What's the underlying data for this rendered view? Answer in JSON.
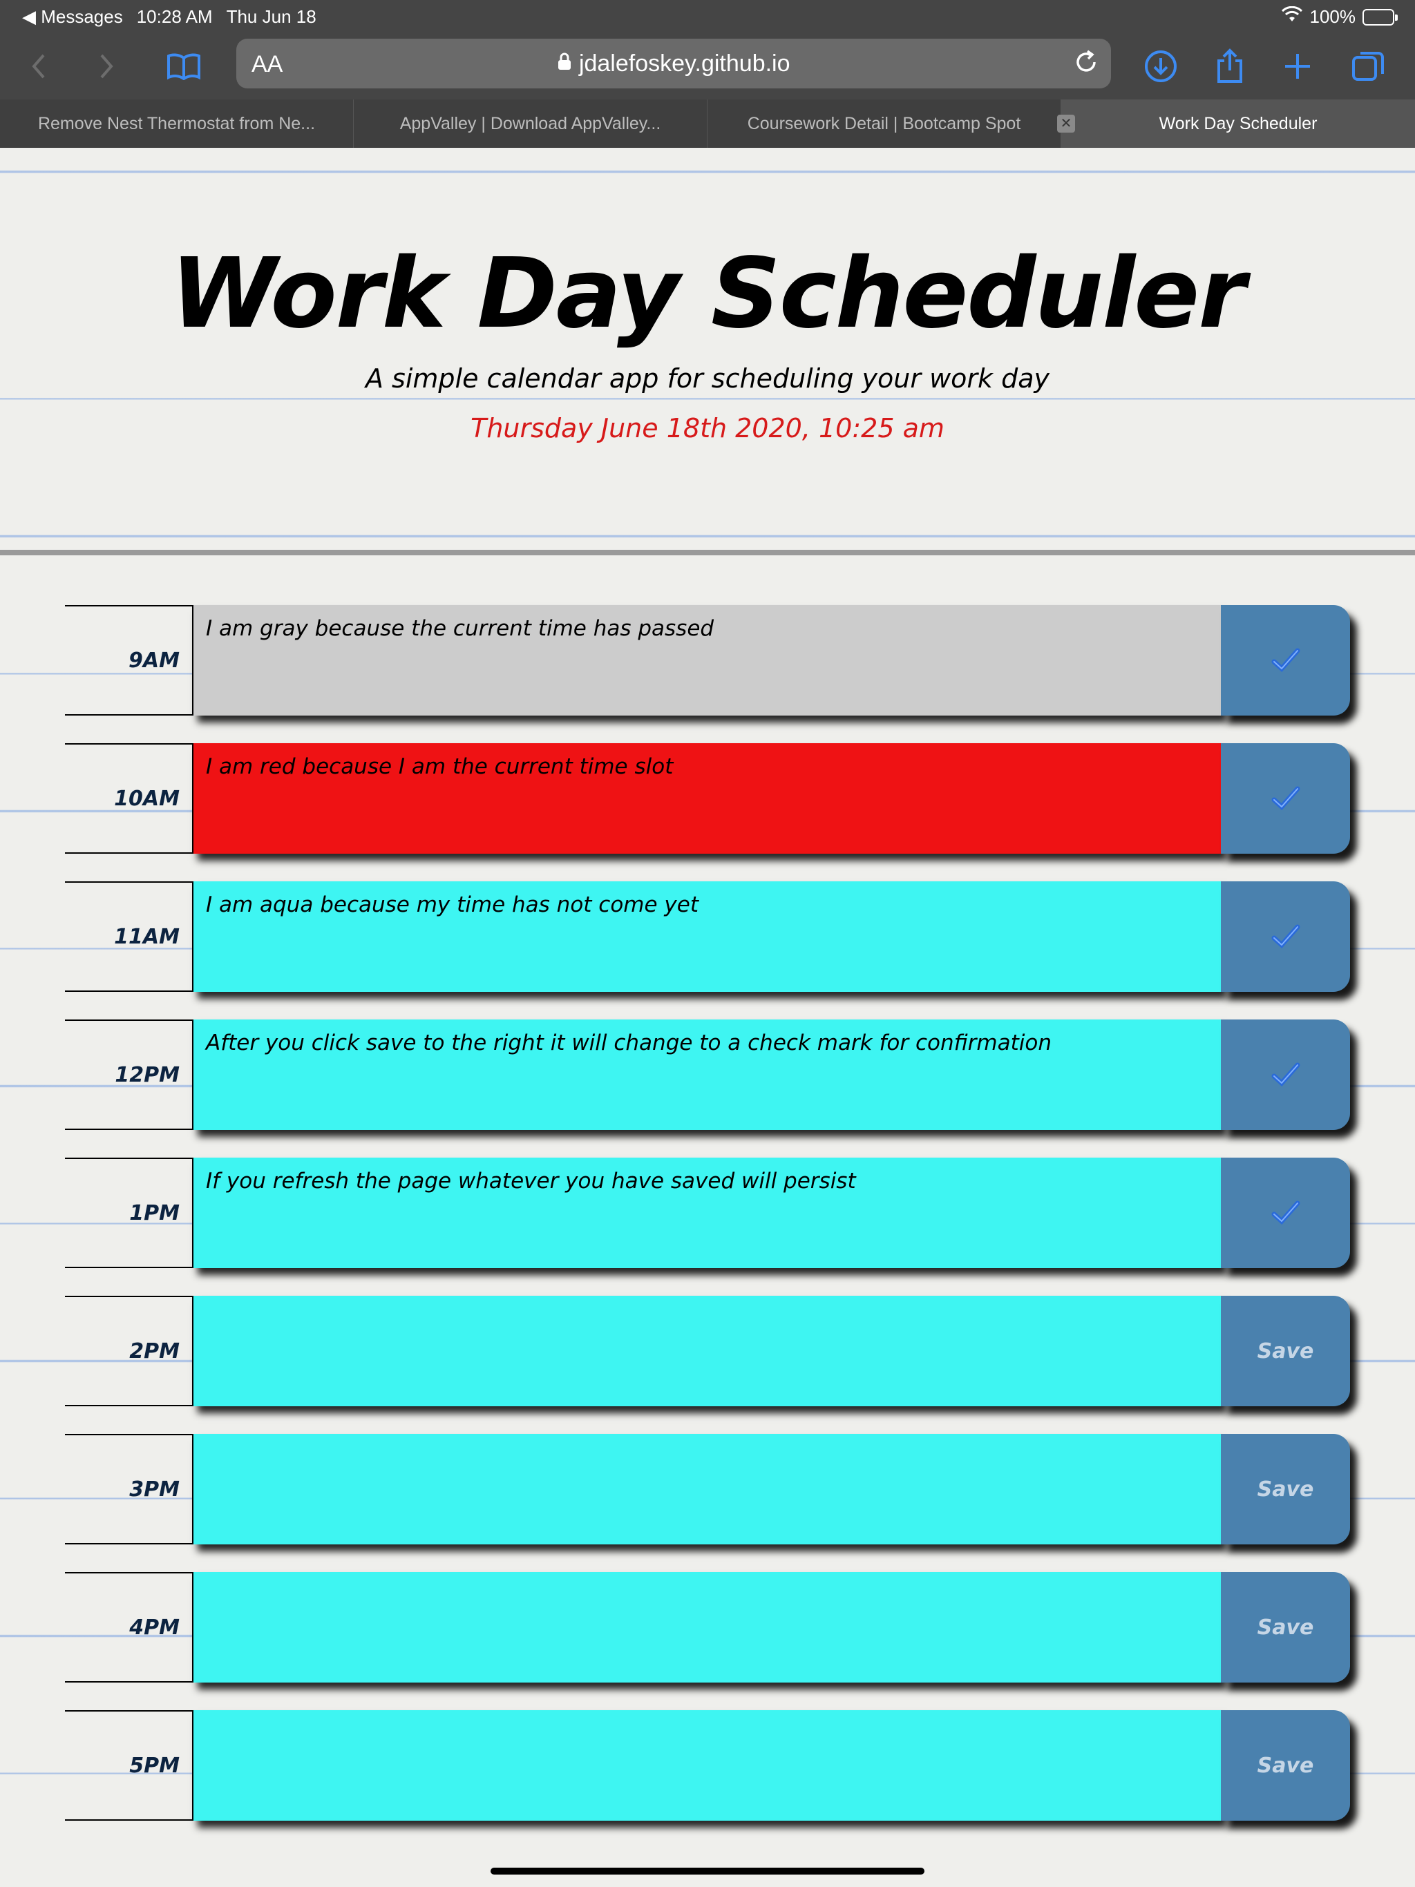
{
  "status_bar": {
    "back_app": "Messages",
    "time": "10:28 AM",
    "date": "Thu Jun 18",
    "battery": "100%"
  },
  "browser": {
    "text_size_label": "AA",
    "url": "jdalefoskey.github.io",
    "tabs": [
      {
        "label": "Remove Nest Thermostat from Ne..."
      },
      {
        "label": "AppValley | Download AppValley..."
      },
      {
        "label": "Coursework Detail | Bootcamp Spot"
      },
      {
        "label": "Work Day Scheduler"
      }
    ],
    "active_tab": 3,
    "accent_color": "#3d8bf2"
  },
  "header": {
    "title": "Work Day Scheduler",
    "subtitle": "A simple calendar app for scheduling your work day",
    "current_day": "Thursday June 18th 2020, 10:25 am"
  },
  "colors": {
    "past": "#cccccc",
    "present": "#ef1214",
    "future": "#3ef5f2",
    "save_button": "#4a81ae"
  },
  "schedule": [
    {
      "hour": "9AM",
      "status": "past",
      "text": "I am gray because the current time has passed",
      "button": "✓",
      "saved": true
    },
    {
      "hour": "10AM",
      "status": "present",
      "text": "I am red because I am the current time slot",
      "button": "✓",
      "saved": true
    },
    {
      "hour": "11AM",
      "status": "future",
      "text": "I am aqua because my time has not come yet",
      "button": "✓",
      "saved": true
    },
    {
      "hour": "12PM",
      "status": "future",
      "text": "After you click save to the right it will change to a check mark for confirmation",
      "button": "✓",
      "saved": true
    },
    {
      "hour": "1PM",
      "status": "future",
      "text": "If you refresh the page whatever you have saved will persist",
      "button": "✓",
      "saved": true
    },
    {
      "hour": "2PM",
      "status": "future",
      "text": "",
      "button": "Save",
      "saved": false
    },
    {
      "hour": "3PM",
      "status": "future",
      "text": "",
      "button": "Save",
      "saved": false
    },
    {
      "hour": "4PM",
      "status": "future",
      "text": "",
      "button": "Save",
      "saved": false
    },
    {
      "hour": "5PM",
      "status": "future",
      "text": "",
      "button": "Save",
      "saved": false
    }
  ]
}
